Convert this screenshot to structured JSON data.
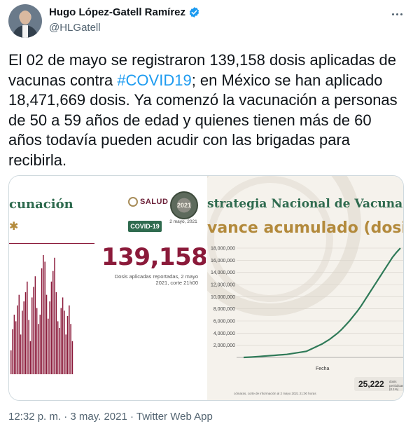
{
  "author": {
    "display_name": "Hugo López-Gatell Ramírez",
    "handle": "@HLGatell",
    "verified": true
  },
  "tweet": {
    "text_before": "El 02 de mayo se registraron 139,158 dosis aplicadas de vacunas contra ",
    "hashtag": "#COVID19",
    "text_after": "; en México se han aplicado 18,471,669 dosis. Ya comenzó la vacunación a personas de 50 a 59 años de edad y quienes tienen más de 60 años todavía pueden acudir con las brigadas para recibirla.",
    "timestamp": "12:32 p. m. · 3 may. 2021 · Twitter Web App"
  },
  "media_left": {
    "title": "cunación",
    "salud_label": "SALUD",
    "seal_label": "2021",
    "covid_tag": "COVID-19",
    "date": "2 mayo, 2021",
    "big_number": "139,158",
    "caption": "Dosis aplicadas reportadas, 2 mayo 2021, corte 21h00",
    "colors": {
      "bars": "#8b1a3a",
      "title": "#2f6b4f"
    }
  },
  "media_right": {
    "title": "strategia Nacional de Vacuna",
    "subtitle": "vance acumulado (dosi",
    "xlabel": "Fecha",
    "footnote": "cómaras, corte de información al 2 mayo 2021 21:00 horas",
    "badge_number": "25,222",
    "badge_text": "dosis periódicas (0.1%)"
  },
  "chart_data": [
    {
      "type": "bar",
      "title": "",
      "xlabel": "",
      "ylabel": "",
      "values": [
        18,
        34,
        45,
        40,
        52,
        60,
        30,
        48,
        55,
        62,
        70,
        41,
        25,
        58,
        66,
        74,
        50,
        38,
        45,
        80,
        90,
        85,
        60,
        42,
        55,
        70,
        78,
        88,
        62,
        40,
        35,
        50,
        58,
        48,
        30,
        44,
        52,
        38,
        25
      ]
    },
    {
      "type": "line",
      "title": "",
      "xlabel": "Fecha",
      "ylabel": "",
      "ylim": [
        0,
        18000000
      ],
      "y_ticks": [
        "2,000,000",
        "4,000,000",
        "6,000,000",
        "8,000,000",
        "10,000,000",
        "12,000,000",
        "14,000,000",
        "16,000,000",
        "18,000,000"
      ],
      "series": [
        {
          "values": [
            0,
            30000,
            60000,
            100000,
            150000,
            200000,
            250000,
            300000,
            350000,
            400000,
            450000,
            500000,
            600000,
            700000,
            800000,
            900000,
            1000000,
            1300000,
            1600000,
            1900000,
            2200000,
            2600000,
            3000000,
            3500000,
            4000000,
            4600000,
            5300000,
            6000000,
            6800000,
            7600000,
            8500000,
            9500000,
            10500000,
            11500000,
            12500000,
            13500000,
            14500000,
            15500000,
            16500000,
            17300000,
            18000000
          ]
        }
      ]
    }
  ]
}
